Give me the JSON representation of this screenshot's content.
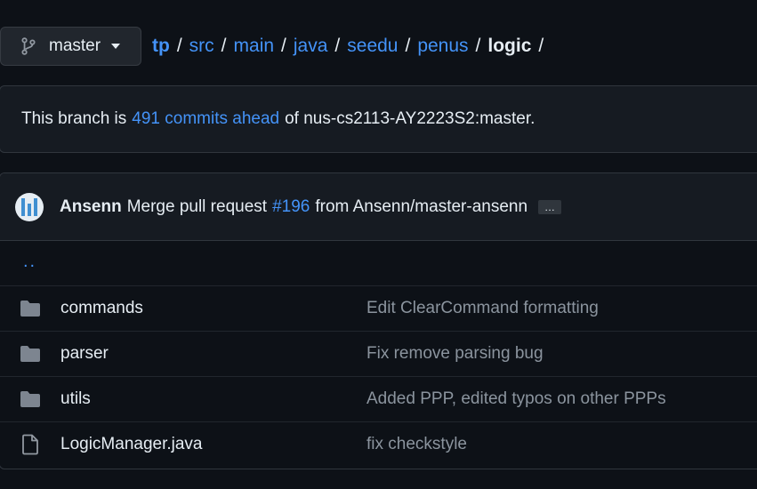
{
  "branch": {
    "name": "master"
  },
  "breadcrumb": {
    "root": "tp",
    "parts": [
      "src",
      "main",
      "java",
      "seedu",
      "penus"
    ],
    "current": "logic",
    "separator": "/"
  },
  "ahead": {
    "prefix": "This branch is",
    "link": "491 commits ahead",
    "suffix": "of nus-cs2113-AY2223S2:master."
  },
  "commit": {
    "author": "Ansenn",
    "message_prefix": "Merge pull request",
    "pr": "#196",
    "message_suffix": "from Ansenn/master-ansenn",
    "more": "…"
  },
  "parent_dir": "..",
  "files": [
    {
      "type": "dir",
      "icon": "folder-icon",
      "name": "commands",
      "message": "Edit ClearCommand formatting"
    },
    {
      "type": "dir",
      "icon": "folder-icon",
      "name": "parser",
      "message": "Fix remove parsing bug"
    },
    {
      "type": "dir",
      "icon": "folder-icon",
      "name": "utils",
      "message": "Added PPP, edited typos on other PPPs"
    },
    {
      "type": "file",
      "icon": "file-icon",
      "name": "LogicManager.java",
      "message": "fix checkstyle"
    }
  ],
  "colors": {
    "background": "#0d1117",
    "link": "#4493f8",
    "muted": "#8b949e",
    "folder": "#7d8590"
  }
}
